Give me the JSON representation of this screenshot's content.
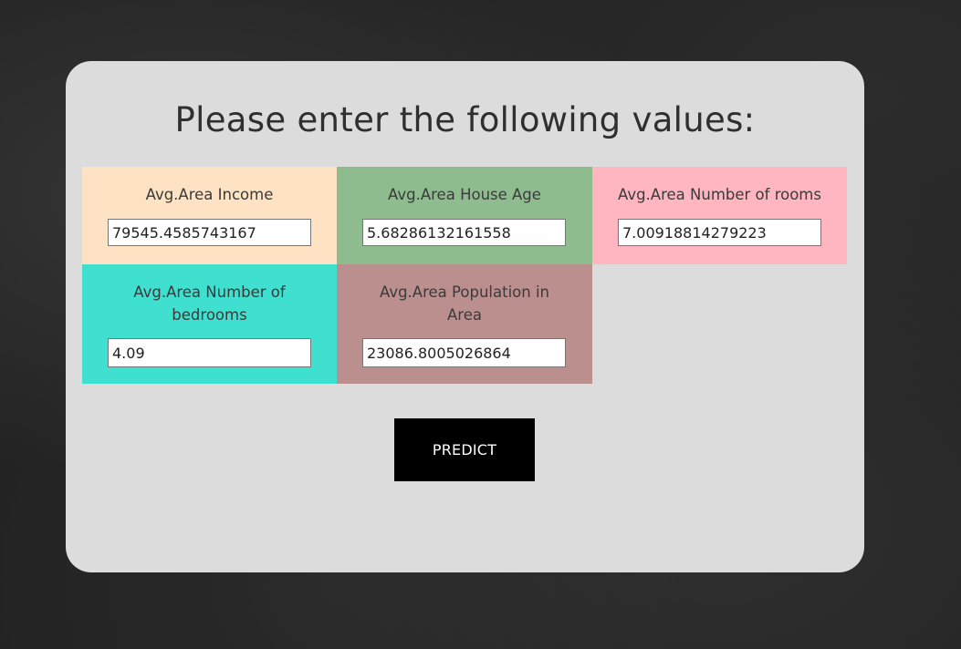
{
  "form": {
    "title": "Please enter the following values:",
    "fields": [
      {
        "label": "Avg.Area Income",
        "value": "79545.4585743167",
        "color": "#fde3c4"
      },
      {
        "label": "Avg.Area House Age",
        "value": "5.68286132161558",
        "color": "#8fbc8f"
      },
      {
        "label": "Avg.Area Number of rooms",
        "value": "7.00918814279223",
        "color": "#ffb6c1"
      },
      {
        "label": "Avg.Area Number of bedrooms",
        "value": "4.09",
        "color": "#40e0d0"
      },
      {
        "label": "Avg.Area Population in Area",
        "value": "23086.8005026864",
        "color": "#bc8f8f"
      }
    ],
    "submit_label": "PREDICT"
  },
  "colors": {
    "page_background": "#232323",
    "card_background": "#dcdcdc",
    "button_background": "#000000",
    "button_text": "#ffffff"
  }
}
